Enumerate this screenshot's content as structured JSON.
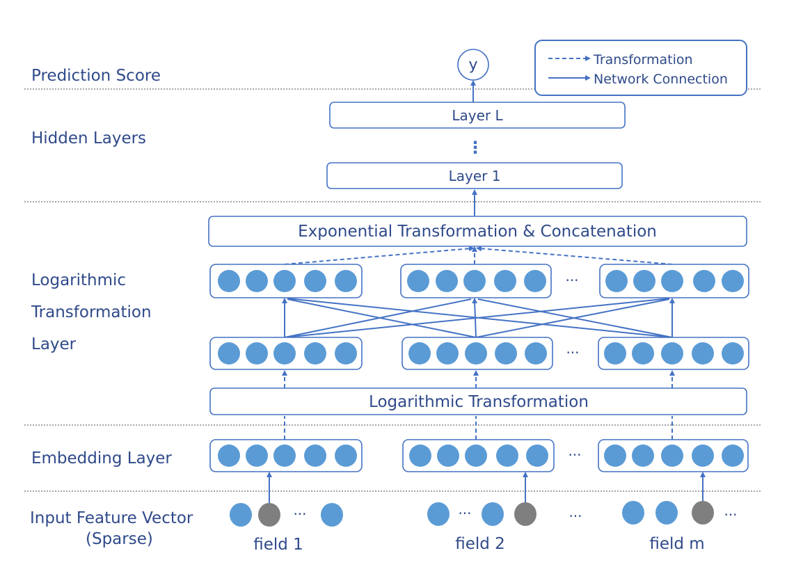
{
  "sections": {
    "prediction": "Prediction Score",
    "hidden": "Hidden Layers",
    "log_line1": "Logarithmic",
    "log_line2": "Transformation",
    "log_line3": "Layer",
    "embedding": "Embedding Layer",
    "input_line1": "Input Feature Vector",
    "input_line2": "(Sparse)"
  },
  "output_node": "y",
  "legend": {
    "dashed": "Transformation",
    "solid": "Network Connection"
  },
  "boxes": {
    "layer_l": "Layer L",
    "hidden_ellipsis": "⋮",
    "layer_1": "Layer 1",
    "exp": "Exponential Transformation & Concatenation",
    "log": "Logarithmic Transformation"
  },
  "ellipsis": "···",
  "fields": [
    "field 1",
    "field 2",
    "field m"
  ],
  "colors": {
    "accent": "#4472C4",
    "neuron": "#5B9BD5",
    "active_feature": "#7F7F7F",
    "text": "#2F4A8A"
  }
}
